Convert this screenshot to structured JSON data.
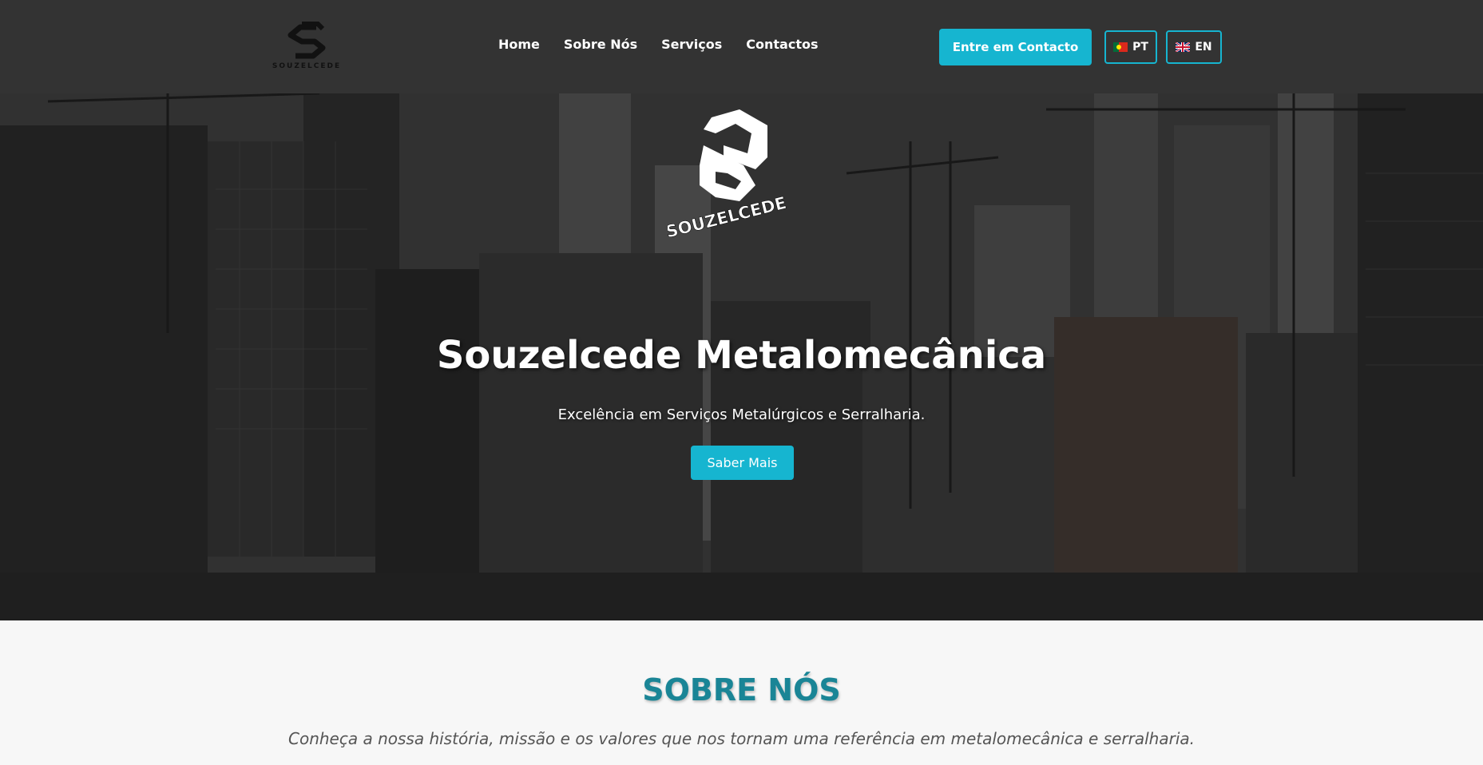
{
  "header": {
    "logo_text": "SOUZELCEDE",
    "nav": [
      {
        "label": "Home"
      },
      {
        "label": "Sobre Nós"
      },
      {
        "label": "Serviços"
      },
      {
        "label": "Contactos"
      }
    ],
    "contact_button": "Entre em Contacto",
    "languages": [
      {
        "code": "PT",
        "flag": "portugal-flag-icon"
      },
      {
        "code": "EN",
        "flag": "uk-flag-icon"
      }
    ]
  },
  "hero": {
    "logo_text": "SOUZELCEDE",
    "title": "Souzelcede Metalomecânica",
    "subtitle": "Excelência em Serviços Metalúrgicos e Serralharia.",
    "button": "Saber Mais"
  },
  "about": {
    "title": "SOBRE NÓS",
    "subtitle": "Conheça a nossa história, missão e os valores que nos tornam uma referência em metalomecânica e serralharia."
  },
  "colors": {
    "accent": "#16b5d0",
    "header_bg": "#333333",
    "about_title": "#1a8596"
  }
}
